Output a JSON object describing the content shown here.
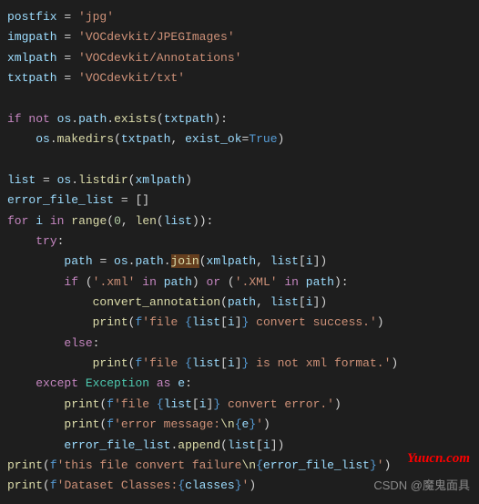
{
  "code": {
    "l1": {
      "v1": "postfix",
      "v2": " = ",
      "s": "'jpg'"
    },
    "l2": {
      "v1": "imgpath",
      "v2": " = ",
      "s": "'VOCdevkit/JPEGImages'"
    },
    "l3": {
      "v1": "xmlpath",
      "v2": " = ",
      "s": "'VOCdevkit/Annotations'"
    },
    "l4": {
      "v1": "txtpath",
      "v2": " = ",
      "s": "'VOCdevkit/txt'"
    },
    "l6": {
      "k1": "if",
      "k2": "not",
      "v1": "os",
      "v2": "path",
      "f": "exists",
      "a": "txtpath"
    },
    "l7": {
      "v1": "os",
      "f": "makedirs",
      "a1": "txtpath",
      "a2": "exist_ok",
      "c": "True"
    },
    "l9": {
      "v1": "list",
      "v2": "os",
      "f": "listdir",
      "a": "xmlpath"
    },
    "l10": {
      "v1": "error_file_list",
      "b": "[]"
    },
    "l11": {
      "k1": "for",
      "v1": "i",
      "k2": "in",
      "f": "range",
      "n": "0",
      "f2": "len",
      "a": "list"
    },
    "l12": {
      "k": "try"
    },
    "l13": {
      "v1": "path",
      "v2": "os",
      "v3": "path",
      "f": "join",
      "a1": "xmlpath",
      "a2": "list",
      "a3": "i"
    },
    "l14": {
      "k1": "if",
      "s1": "'.xml'",
      "k2": "in",
      "v1": "path",
      "k3": "or",
      "s2": "'.XML'",
      "v2": "path"
    },
    "l15": {
      "f": "convert_annotation",
      "a1": "path",
      "a2": "list",
      "a3": "i"
    },
    "l16": {
      "f": "print",
      "fp": "f",
      "s1": "'file ",
      "b1": "{",
      "v1": "list",
      "v2": "i",
      "b2": "}",
      "s2": " convert success.'"
    },
    "l17": {
      "k": "else"
    },
    "l18": {
      "f": "print",
      "fp": "f",
      "s1": "'file ",
      "b1": "{",
      "v1": "list",
      "v2": "i",
      "b2": "}",
      "s2": " is not xml format.'"
    },
    "l19": {
      "k1": "except",
      "c": "Exception",
      "k2": "as",
      "v": "e"
    },
    "l20": {
      "f": "print",
      "fp": "f",
      "s1": "'file ",
      "b1": "{",
      "v1": "list",
      "v2": "i",
      "b2": "}",
      "s2": " convert error.'"
    },
    "l21": {
      "f": "print",
      "fp": "f",
      "s1": "'error message:",
      "esc": "\\n",
      "b1": "{",
      "v": "e",
      "b2": "}",
      "s2": "'"
    },
    "l22": {
      "v1": "error_file_list",
      "f": "append",
      "a1": "list",
      "a2": "i"
    },
    "l23": {
      "f": "print",
      "fp": "f",
      "s1": "'this file convert failure",
      "esc": "\\n",
      "b1": "{",
      "v": "error_file_list",
      "b2": "}",
      "s2": "'"
    },
    "l24": {
      "f": "print",
      "fp": "f",
      "s1": "'Dataset Classes:",
      "b1": "{",
      "v": "classes",
      "b2": "}",
      "s2": "'"
    }
  },
  "watermark": {
    "red": "Yuucn.com",
    "gray": "CSDN @魔鬼面具"
  }
}
